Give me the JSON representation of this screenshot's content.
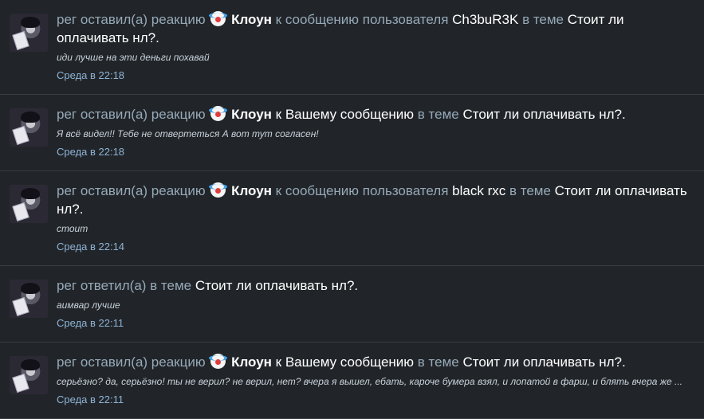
{
  "feed": {
    "items": [
      {
        "user": "рег",
        "action": "оставил(а) реакцию",
        "reaction": "Клоун",
        "target_prefix": "к сообщению пользователя",
        "target_user": "Ch3buR3K",
        "in_thread": "в теме",
        "thread": "Стоит ли оплачивать нл?.",
        "snippet": "иди лучше на эти деньги похавай",
        "time": "Среда в 22:18",
        "icon": "clown-icon"
      },
      {
        "user": "рег",
        "action": "оставил(а) реакцию",
        "reaction": "Клоун",
        "target_prefix": "к Вашему сообщению",
        "target_user": "",
        "in_thread": "в теме",
        "thread": "Стоит ли оплачивать нл?.",
        "snippet": "Я всё видел!! Тебе не отвертеться А вот тут согласен!",
        "time": "Среда в 22:18",
        "icon": "clown-icon"
      },
      {
        "user": "рег",
        "action": "оставил(а) реакцию",
        "reaction": "Клоун",
        "target_prefix": "к сообщению пользователя",
        "target_user": "black rxc",
        "in_thread": "в теме",
        "thread": "Стоит ли оплачивать нл?.",
        "snippet": "стоит",
        "time": "Среда в 22:14",
        "icon": "clown-icon"
      },
      {
        "user": "рег",
        "action": "ответил(а)",
        "reaction": "",
        "target_prefix": "",
        "target_user": "",
        "in_thread": "в теме",
        "thread": "Стоит ли оплачивать нл?.",
        "snippet": "аимвар лучше",
        "time": "Среда в 22:11",
        "icon": ""
      },
      {
        "user": "рег",
        "action": "оставил(а) реакцию",
        "reaction": "Клоун",
        "target_prefix": "к Вашему сообщению",
        "target_user": "",
        "in_thread": "в теме",
        "thread": "Стоит ли оплачивать нл?.",
        "snippet": "серьёзно? да, серьёзно! ты не верил? не верил, нет? вчера я вышел, ебать, кароче бумера взял, и лопатой в фарш, и блять вчера же ...",
        "time": "Среда в 22:11",
        "icon": "clown-icon"
      }
    ]
  }
}
